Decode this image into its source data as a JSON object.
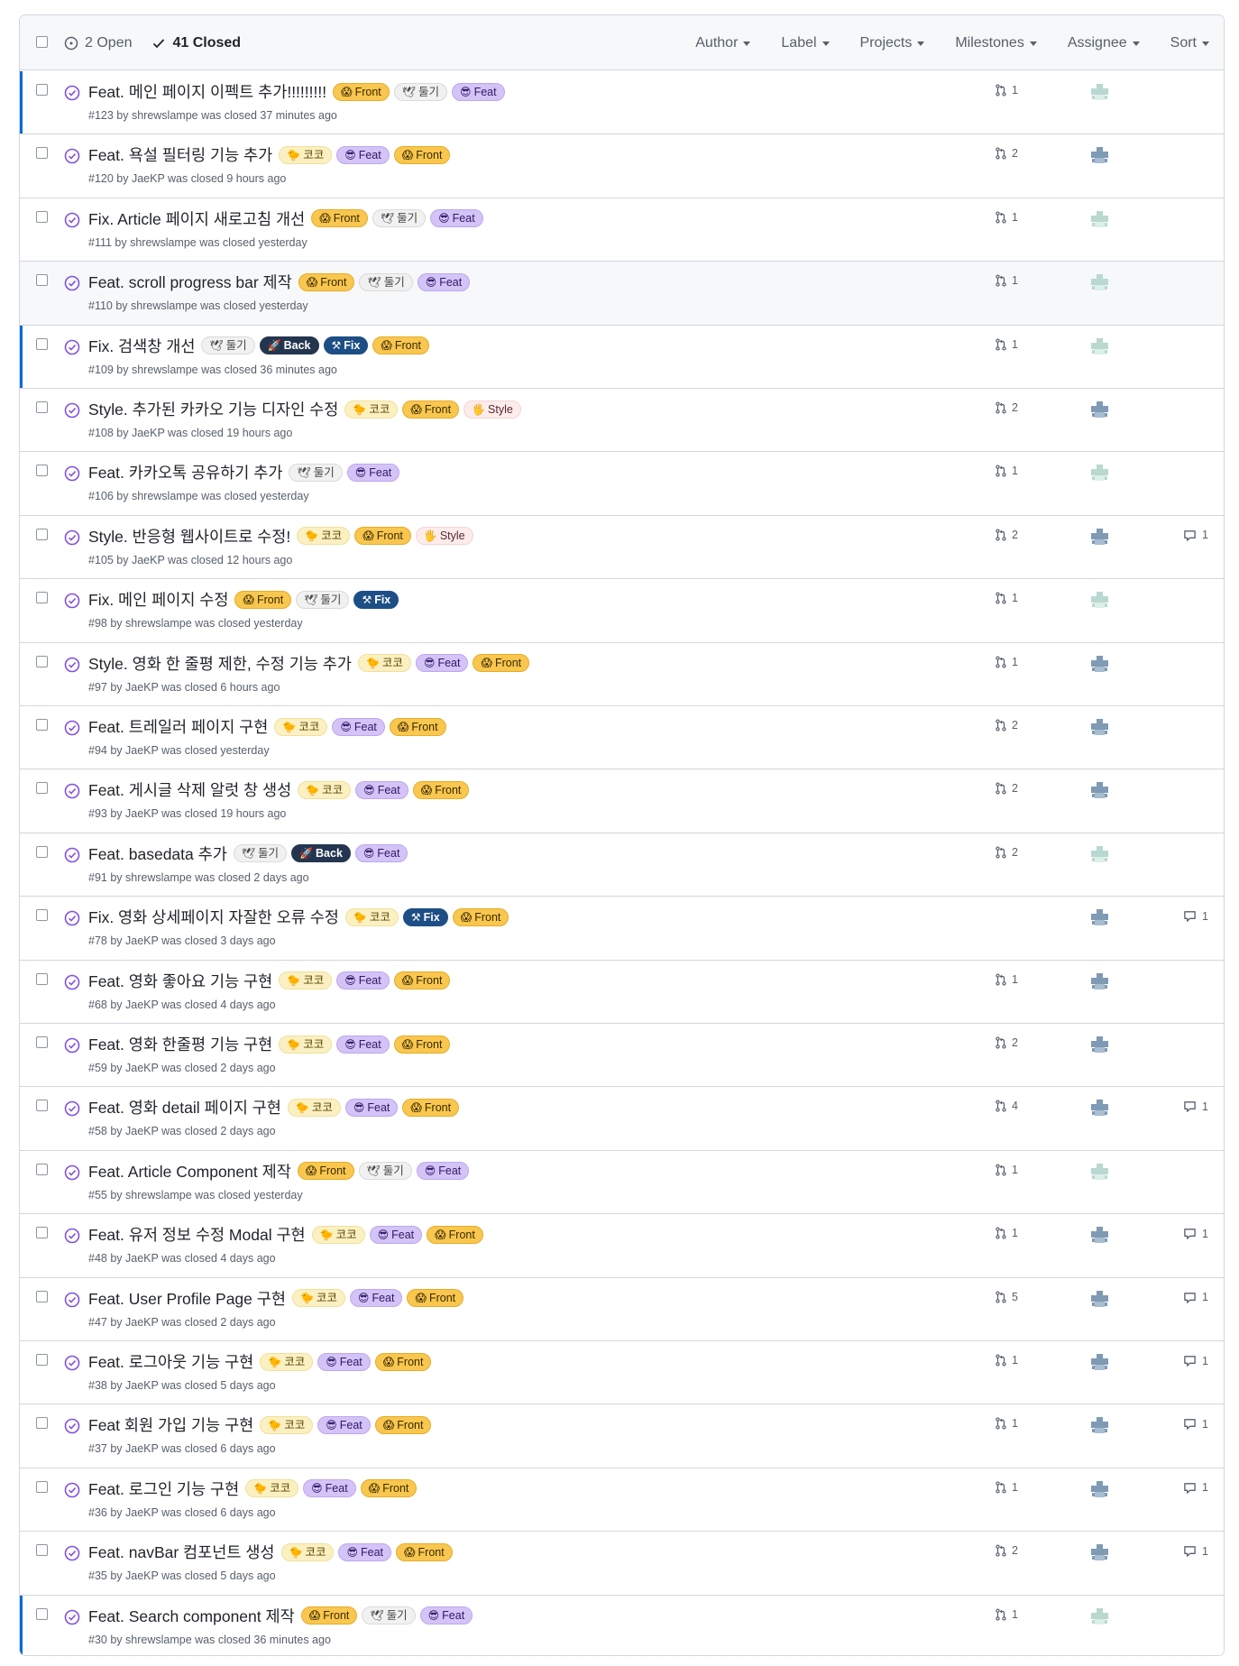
{
  "header": {
    "open_label": "2 Open",
    "closed_label": "41 Closed",
    "filters": [
      "Author",
      "Label",
      "Projects",
      "Milestones",
      "Assignee",
      "Sort"
    ]
  },
  "colors": {
    "accent_unread": "#0969da",
    "closed_icon": "#8250df",
    "label_front": "#f9c74f",
    "label_feat": "#d4c3f7",
    "label_back": "#24364f",
    "label_fix": "#1d4f86"
  },
  "labels": {
    "front": {
      "text": "Front",
      "icon": "shocked-face-icon"
    },
    "dulgi": {
      "text": "둘기",
      "icon": "dove-icon"
    },
    "feat": {
      "text": "Feat",
      "icon": "sunglasses-face-icon"
    },
    "coco": {
      "text": "코코",
      "icon": "bird-icon"
    },
    "back": {
      "text": "Back",
      "icon": "rocket-icon"
    },
    "fix": {
      "text": "Fix",
      "icon": "hammer-wrench-icon"
    },
    "style": {
      "text": "Style",
      "icon": "fingerprint-icon"
    }
  },
  "issues": [
    {
      "title": "Feat. 메인 페이지 이펙트 추가!!!!!!!!!",
      "meta": "#123 by shrewslampe was closed 37 minutes ago",
      "labels": [
        "front",
        "dulgi",
        "feat"
      ],
      "prs": "1",
      "comments": "",
      "avatar": "light",
      "unread": true
    },
    {
      "title": "Feat. 욕설 필터링 기능 추가",
      "meta": "#120 by JaeKP was closed 9 hours ago",
      "labels": [
        "coco",
        "feat",
        "front"
      ],
      "prs": "2",
      "comments": "",
      "avatar": "dark"
    },
    {
      "title": "Fix. Article 페이지 새로고침 개선",
      "meta": "#111 by shrewslampe was closed yesterday",
      "labels": [
        "front",
        "dulgi",
        "feat"
      ],
      "prs": "1",
      "comments": "",
      "avatar": "light"
    },
    {
      "title": "Feat. scroll progress bar 제작",
      "meta": "#110 by shrewslampe was closed yesterday",
      "labels": [
        "front",
        "dulgi",
        "feat"
      ],
      "prs": "1",
      "comments": "",
      "avatar": "light",
      "highlight": true
    },
    {
      "title": "Fix. 검색창 개선",
      "meta": "#109 by shrewslampe was closed 36 minutes ago",
      "labels": [
        "dulgi",
        "back",
        "fix",
        "front"
      ],
      "prs": "1",
      "comments": "",
      "avatar": "light",
      "unread": true
    },
    {
      "title": "Style. 추가된 카카오 기능 디자인 수정",
      "meta": "#108 by JaeKP was closed 19 hours ago",
      "labels": [
        "coco",
        "front",
        "style"
      ],
      "prs": "2",
      "comments": "",
      "avatar": "dark"
    },
    {
      "title": "Feat. 카카오톡 공유하기 추가",
      "meta": "#106 by shrewslampe was closed yesterday",
      "labels": [
        "dulgi",
        "feat"
      ],
      "prs": "1",
      "comments": "",
      "avatar": "light"
    },
    {
      "title": "Style. 반응형 웹사이트로 수정!",
      "meta": "#105 by JaeKP was closed 12 hours ago",
      "labels": [
        "coco",
        "front",
        "style"
      ],
      "prs": "2",
      "comments": "1",
      "avatar": "dark"
    },
    {
      "title": "Fix. 메인 페이지 수정",
      "meta": "#98 by shrewslampe was closed yesterday",
      "labels": [
        "front",
        "dulgi",
        "fix"
      ],
      "prs": "1",
      "comments": "",
      "avatar": "light"
    },
    {
      "title": "Style. 영화 한 줄평 제한, 수정 기능 추가",
      "meta": "#97 by JaeKP was closed 6 hours ago",
      "labels": [
        "coco",
        "feat",
        "front"
      ],
      "prs": "1",
      "comments": "",
      "avatar": "dark"
    },
    {
      "title": "Feat. 트레일러 페이지 구현",
      "meta": "#94 by JaeKP was closed yesterday",
      "labels": [
        "coco",
        "feat",
        "front"
      ],
      "prs": "2",
      "comments": "",
      "avatar": "dark"
    },
    {
      "title": "Feat. 게시글 삭제 알럿 창 생성",
      "meta": "#93 by JaeKP was closed 19 hours ago",
      "labels": [
        "coco",
        "feat",
        "front"
      ],
      "prs": "2",
      "comments": "",
      "avatar": "dark"
    },
    {
      "title": "Feat. basedata 추가",
      "meta": "#91 by shrewslampe was closed 2 days ago",
      "labels": [
        "dulgi",
        "back",
        "feat"
      ],
      "prs": "2",
      "comments": "",
      "avatar": "light"
    },
    {
      "title": "Fix. 영화 상세페이지 자잘한 오류 수정",
      "meta": "#78 by JaeKP was closed 3 days ago",
      "labels": [
        "coco",
        "fix",
        "front"
      ],
      "prs": "",
      "comments": "1",
      "avatar": "dark"
    },
    {
      "title": "Feat. 영화 좋아요 기능 구현",
      "meta": "#68 by JaeKP was closed 4 days ago",
      "labels": [
        "coco",
        "feat",
        "front"
      ],
      "prs": "1",
      "comments": "",
      "avatar": "dark"
    },
    {
      "title": "Feat. 영화 한줄평 기능 구현",
      "meta": "#59 by JaeKP was closed 2 days ago",
      "labels": [
        "coco",
        "feat",
        "front"
      ],
      "prs": "2",
      "comments": "",
      "avatar": "dark"
    },
    {
      "title": "Feat. 영화 detail 페이지 구현",
      "meta": "#58 by JaeKP was closed 2 days ago",
      "labels": [
        "coco",
        "feat",
        "front"
      ],
      "prs": "4",
      "comments": "1",
      "avatar": "dark"
    },
    {
      "title": "Feat. Article Component 제작",
      "meta": "#55 by shrewslampe was closed yesterday",
      "labels": [
        "front",
        "dulgi",
        "feat"
      ],
      "prs": "1",
      "comments": "",
      "avatar": "light"
    },
    {
      "title": "Feat. 유저 정보 수정 Modal 구현",
      "meta": "#48 by JaeKP was closed 4 days ago",
      "labels": [
        "coco",
        "feat",
        "front"
      ],
      "prs": "1",
      "comments": "1",
      "avatar": "dark"
    },
    {
      "title": "Feat. User Profile Page 구현",
      "meta": "#47 by JaeKP was closed 2 days ago",
      "labels": [
        "coco",
        "feat",
        "front"
      ],
      "prs": "5",
      "comments": "1",
      "avatar": "dark"
    },
    {
      "title": "Feat. 로그아웃 기능 구현",
      "meta": "#38 by JaeKP was closed 5 days ago",
      "labels": [
        "coco",
        "feat",
        "front"
      ],
      "prs": "1",
      "comments": "1",
      "avatar": "dark"
    },
    {
      "title": "Feat 회원 가입 기능 구현",
      "meta": "#37 by JaeKP was closed 6 days ago",
      "labels": [
        "coco",
        "feat",
        "front"
      ],
      "prs": "1",
      "comments": "1",
      "avatar": "dark"
    },
    {
      "title": "Feat. 로그인 기능 구현",
      "meta": "#36 by JaeKP was closed 6 days ago",
      "labels": [
        "coco",
        "feat",
        "front"
      ],
      "prs": "1",
      "comments": "1",
      "avatar": "dark"
    },
    {
      "title": "Feat. navBar 컴포넌트 생성",
      "meta": "#35 by JaeKP was closed 5 days ago",
      "labels": [
        "coco",
        "feat",
        "front"
      ],
      "prs": "2",
      "comments": "1",
      "avatar": "dark"
    },
    {
      "title": "Feat. Search component 제작",
      "meta": "#30 by shrewslampe was closed 36 minutes ago",
      "labels": [
        "front",
        "dulgi",
        "feat"
      ],
      "prs": "1",
      "comments": "",
      "avatar": "light",
      "unread": true
    }
  ]
}
